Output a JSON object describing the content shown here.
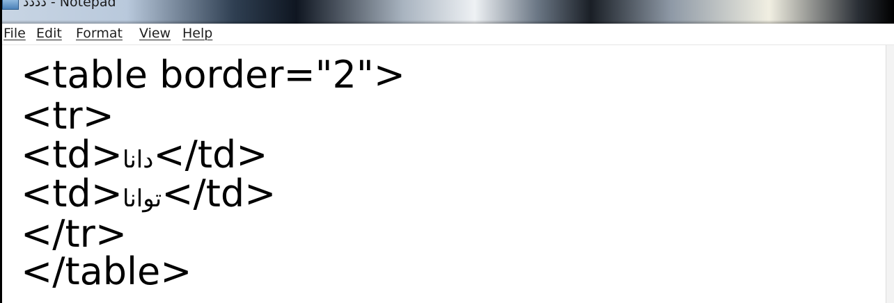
{
  "window": {
    "title": "دددد - Notepad",
    "app_icon": "notepad-icon",
    "accent": "#000000"
  },
  "menu": {
    "file": "File",
    "edit": "Edit",
    "format": "Format",
    "view": "View",
    "help": "Help"
  },
  "editor": {
    "lines": [
      {
        "text": "<table border=\"2\">"
      },
      {
        "text": "<tr>"
      },
      {
        "prefix": "<td>",
        "arabic": "دانا",
        "suffix": "</td>"
      },
      {
        "prefix": "<td>",
        "arabic": "توانا",
        "suffix": "</td>"
      },
      {
        "text": "</tr>"
      },
      {
        "text": "</table>"
      }
    ]
  }
}
